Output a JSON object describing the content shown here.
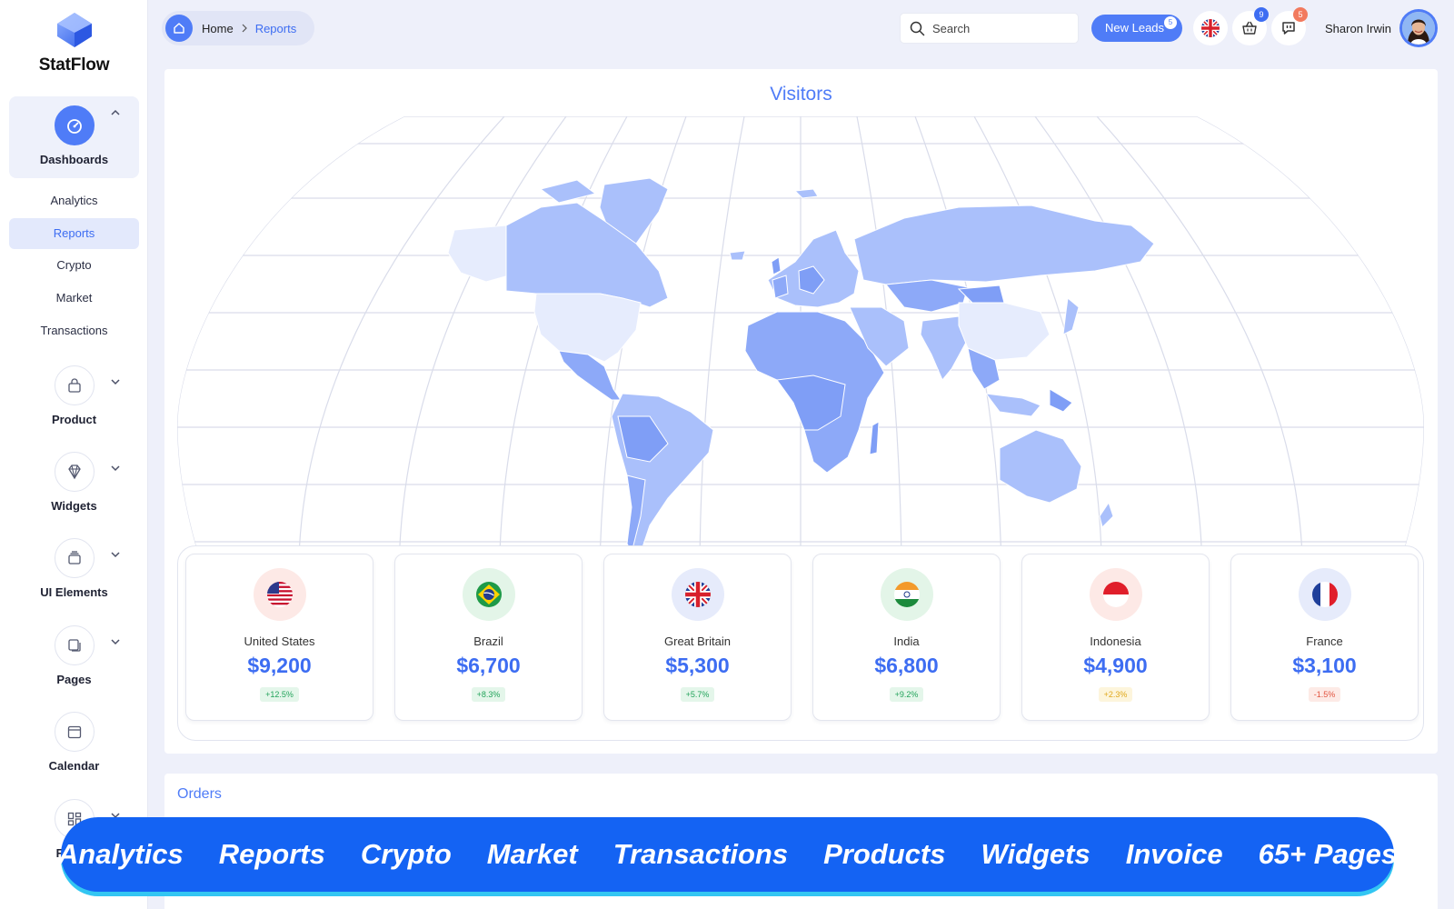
{
  "app": {
    "name": "StatFlow"
  },
  "sidebar": {
    "dashboards": {
      "label": "Dashboards",
      "items": [
        {
          "label": "Analytics"
        },
        {
          "label": "Reports",
          "active": true
        },
        {
          "label": "Crypto"
        },
        {
          "label": "Market"
        },
        {
          "label": "Transactions"
        }
      ]
    },
    "groups": [
      {
        "label": "Product",
        "icon": "bag-icon"
      },
      {
        "label": "Widgets",
        "icon": "diamond-icon"
      },
      {
        "label": "UI Elements",
        "icon": "layers-icon"
      },
      {
        "label": "Pages",
        "icon": "pages-icon"
      },
      {
        "label": "Calendar",
        "icon": "calendar-icon"
      },
      {
        "label": "Forms",
        "icon": "grid-icon"
      }
    ]
  },
  "breadcrumb": {
    "home": "Home",
    "current": "Reports"
  },
  "search": {
    "placeholder": "Search"
  },
  "header": {
    "new_leads_label": "New Leads",
    "new_leads_count": "5",
    "cart_count": "9",
    "messages_count": "5",
    "user_name": "Sharon Irwin"
  },
  "visitors": {
    "title": "Visitors",
    "countries": [
      {
        "name": "United States",
        "amount": "$9,200",
        "change": "+12.5%",
        "trend": "up",
        "flag": "us-flag-icon"
      },
      {
        "name": "Brazil",
        "amount": "$6,700",
        "change": "+8.3%",
        "trend": "up",
        "flag": "brazil-flag-icon"
      },
      {
        "name": "Great Britain",
        "amount": "$5,300",
        "change": "+5.7%",
        "trend": "up",
        "flag": "uk-flag-icon"
      },
      {
        "name": "India",
        "amount": "$6,800",
        "change": "+9.2%",
        "trend": "up",
        "flag": "india-flag-icon"
      },
      {
        "name": "Indonesia",
        "amount": "$4,900",
        "change": "+2.3%",
        "trend": "neutral",
        "flag": "indonesia-flag-icon"
      },
      {
        "name": "France",
        "amount": "$3,100",
        "change": "-1.5%",
        "trend": "down",
        "flag": "france-flag-icon"
      }
    ]
  },
  "orders": {
    "title": "Orders"
  },
  "banner": {
    "items": [
      "Analytics",
      "Reports",
      "Crypto",
      "Market",
      "Transactions",
      "Products",
      "Widgets",
      "Invoice",
      "65+ Pages"
    ]
  },
  "colors": {
    "accent": "#4f7cf7",
    "banner": "#1463f3",
    "banner_shadow": "#33c6f2",
    "up": "#22a35a",
    "neutral": "#e0a81b",
    "down": "#e2533f"
  }
}
